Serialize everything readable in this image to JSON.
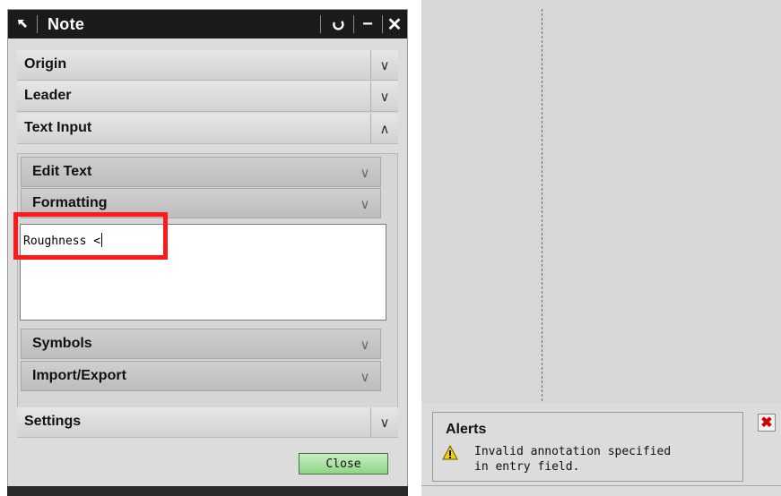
{
  "dialog": {
    "title": "Note",
    "title_icon": "arrow-icon",
    "buttons": {
      "reset": "↺",
      "minimize": "−",
      "close": "✕"
    },
    "sections": [
      {
        "label": "Origin",
        "state": "collapsed",
        "chevron": "∨"
      },
      {
        "label": "Leader",
        "state": "collapsed",
        "chevron": "∨"
      },
      {
        "label": "Text Input",
        "state": "expanded",
        "chevron": "∧"
      },
      {
        "label": "Settings",
        "state": "collapsed",
        "chevron": "∨"
      }
    ],
    "text_input": {
      "subsections": [
        {
          "label": "Edit Text",
          "chevron": "∨"
        },
        {
          "label": "Formatting",
          "chevron": "∨"
        },
        {
          "label": "Symbols",
          "chevron": "∨"
        },
        {
          "label": "Import/Export",
          "chevron": "∨"
        }
      ],
      "text_value": "Roughness <"
    },
    "close_label": "Close"
  },
  "alerts": {
    "title": "Alerts",
    "message_line1": "Invalid annotation specified",
    "message_line2": "in entry field.",
    "close_symbol": "✖"
  },
  "colors": {
    "titlebar": "#1b1b1b",
    "highlight": "#ff1a1a",
    "close_button": "#8fd487",
    "alert_close": "#d20000",
    "warning": "#f3d000"
  }
}
